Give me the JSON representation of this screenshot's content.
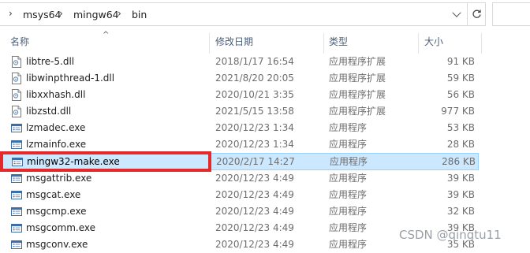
{
  "address": {
    "breadcrumbs": [
      "msys64",
      "mingw64",
      "bin"
    ],
    "separator": "›",
    "leading_separator": "›"
  },
  "columns": {
    "name": "名称",
    "date": "修改日期",
    "type": "类型",
    "size": "大小"
  },
  "files": [
    {
      "name": "libtre-5.dll",
      "date": "2018/1/17 16:54",
      "type": "应用程序扩展",
      "size": "91 KB",
      "icon": "dll-icon"
    },
    {
      "name": "libwinpthread-1.dll",
      "date": "2021/8/20 20:05",
      "type": "应用程序扩展",
      "size": "59 KB",
      "icon": "dll-icon"
    },
    {
      "name": "libxxhash.dll",
      "date": "2020/10/21 3:35",
      "type": "应用程序扩展",
      "size": "56 KB",
      "icon": "dll-icon"
    },
    {
      "name": "libzstd.dll",
      "date": "2021/5/15 13:58",
      "type": "应用程序扩展",
      "size": "977 KB",
      "icon": "dll-icon"
    },
    {
      "name": "lzmadec.exe",
      "date": "2020/12/23 1:34",
      "type": "应用程序",
      "size": "53 KB",
      "icon": "exe-icon"
    },
    {
      "name": "lzmainfo.exe",
      "date": "2020/12/23 1:34",
      "type": "应用程序",
      "size": "28 KB",
      "icon": "exe-icon"
    },
    {
      "name": "mingw32-make.exe",
      "date": "2020/2/17 14:27",
      "type": "应用程序",
      "size": "286 KB",
      "icon": "exe-icon",
      "selected": true
    },
    {
      "name": "msgattrib.exe",
      "date": "2020/12/23 4:49",
      "type": "应用程序",
      "size": "39 KB",
      "icon": "exe-icon"
    },
    {
      "name": "msgcat.exe",
      "date": "2020/12/23 4:49",
      "type": "应用程序",
      "size": "39 KB",
      "icon": "exe-icon"
    },
    {
      "name": "msgcmp.exe",
      "date": "2020/12/23 4:49",
      "type": "应用程序",
      "size": "32 KB",
      "icon": "exe-icon"
    },
    {
      "name": "msgcomm.exe",
      "date": "2020/12/23 4:49",
      "type": "应用程序",
      "size": "39 KB",
      "icon": "exe-icon"
    },
    {
      "name": "msgconv.exe",
      "date": "2020/12/23 4:49",
      "type": "应用程序",
      "size": "35 KB",
      "icon": "exe-icon"
    }
  ],
  "watermark": "CSDN @qingtu11",
  "colors": {
    "selection_bg": "#cce8ff",
    "selection_border": "#99d1ff",
    "highlight_box": "#e32929",
    "header_text": "#4c607a"
  }
}
